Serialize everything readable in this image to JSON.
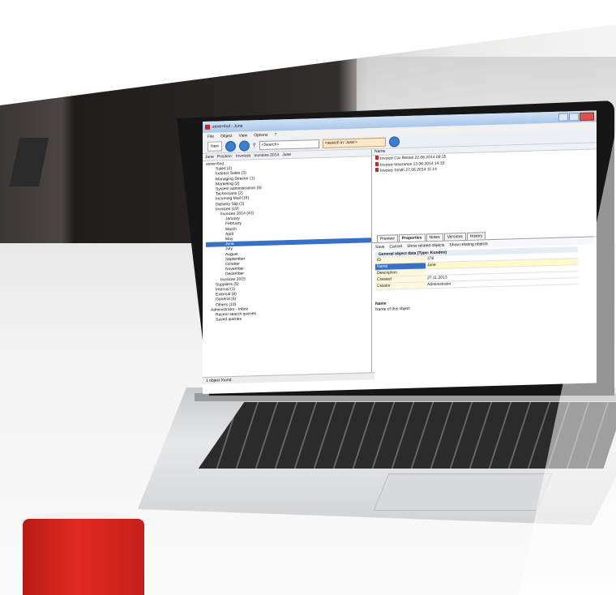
{
  "window": {
    "title": "store+find - June"
  },
  "menu": [
    "File",
    "Object",
    "View",
    "Options",
    "?"
  ],
  "toolbar": {
    "new_label": "New",
    "search_placeholder": "<Search>",
    "search_in_label": "<search in 'June'>"
  },
  "breadcrumb": {
    "current": "June",
    "position_label": "Position:",
    "path": [
      "Invoices",
      "Invoices 2014",
      "June"
    ]
  },
  "tree": [
    "store+find",
    "Sales (2)",
    "Indirect Sales (3)",
    "Managing Director (1)",
    "Marketing (2)",
    "System administration (9)",
    "Technicians (2)",
    "Incoming Mail (16)",
    "Delivery Slip (3)",
    "Invoices (19)",
    "Invoices 2014 (43)",
    "January",
    "February",
    "March",
    "April",
    "May",
    "June",
    "July",
    "August",
    "September",
    "October",
    "November",
    "December",
    "Invoices 2015",
    "Suppliers (5)",
    "Internal (1)",
    "External (8)",
    "General (6)",
    "Others (10)",
    "Administrator - Inbox",
    "Recent search queries",
    "Saved queries"
  ],
  "tree_selected": "June",
  "status": "1 object found",
  "list": {
    "header": "Name",
    "items": [
      "Invoice Car Rental 22.06.2014 09:15",
      "Invoice Insurance 13.06.2014 14:15",
      "Invoice Smith 27.06.2014 11:14"
    ]
  },
  "tabs": [
    "Preview",
    "Properties",
    "Notes",
    "Versions",
    "History"
  ],
  "active_tab": "Properties",
  "actions": [
    "Save",
    "Cancel",
    "Show related objects",
    "Show relating objects"
  ],
  "properties": {
    "section": "General object data (Type: Kunden)",
    "rows": [
      {
        "key": "ID",
        "value": "376"
      },
      {
        "key": "Name",
        "value": "June"
      },
      {
        "key": "Description",
        "value": ""
      },
      {
        "key": "Created",
        "value": "27.11.2013"
      },
      {
        "key": "Creator",
        "value": "Administrator"
      }
    ]
  },
  "name_help": {
    "title": "Name",
    "text": "Name of this object"
  }
}
